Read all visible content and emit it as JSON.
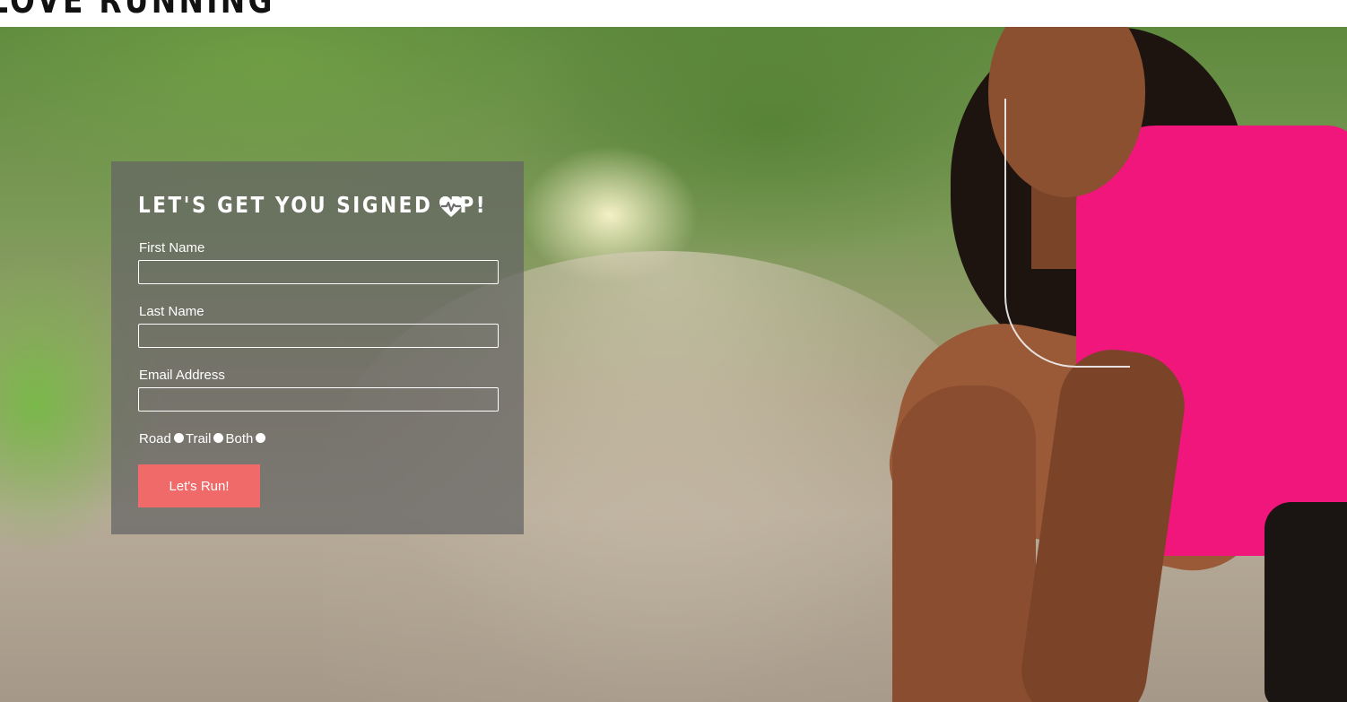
{
  "header": {
    "site_title": "LOVE RUNNING"
  },
  "hero": {
    "image_description_icon": "runner-photo"
  },
  "form": {
    "title": "LET'S GET YOU SIGNED UP!",
    "title_icon": "heart-pulse-icon",
    "fields": [
      {
        "label": "First Name",
        "value": ""
      },
      {
        "label": "Last Name",
        "value": ""
      },
      {
        "label": "Email Address",
        "value": ""
      }
    ],
    "radio_options": [
      "Road",
      "Trail",
      "Both"
    ],
    "submit_label": "Let's Run!"
  },
  "colors": {
    "button": "#f06a6a",
    "card_bg": "rgba(100,100,100,0.72)",
    "shirt": "#f0167b"
  }
}
